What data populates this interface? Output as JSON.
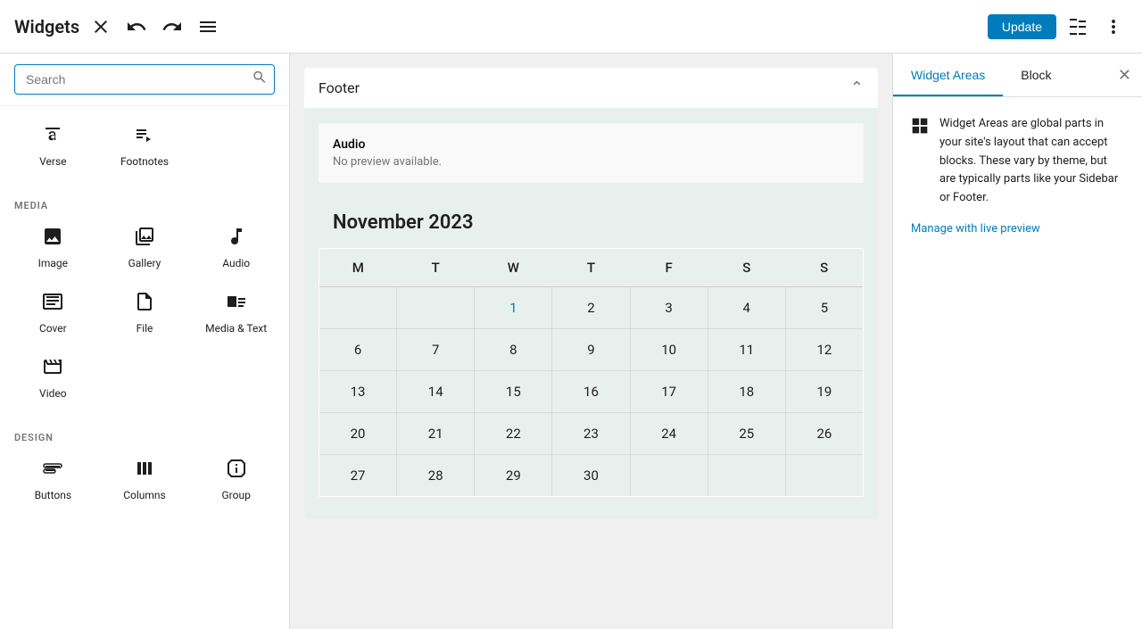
{
  "topbar": {
    "title": "Widgets",
    "update_label": "Update"
  },
  "sidebar": {
    "search": {
      "placeholder": "Search",
      "value": ""
    },
    "sections": [
      {
        "id": "text",
        "label": "",
        "blocks": [
          {
            "id": "verse",
            "icon": "verse",
            "label": "Verse"
          },
          {
            "id": "footnotes",
            "icon": "footnotes",
            "label": "Footnotes"
          }
        ]
      },
      {
        "id": "media",
        "label": "MEDIA",
        "blocks": [
          {
            "id": "image",
            "icon": "image",
            "label": "Image"
          },
          {
            "id": "gallery",
            "icon": "gallery",
            "label": "Gallery"
          },
          {
            "id": "audio",
            "icon": "audio",
            "label": "Audio"
          },
          {
            "id": "cover",
            "icon": "cover",
            "label": "Cover"
          },
          {
            "id": "file",
            "icon": "file",
            "label": "File"
          },
          {
            "id": "media-text",
            "icon": "media-text",
            "label": "Media & Text"
          },
          {
            "id": "video",
            "icon": "video",
            "label": "Video"
          }
        ]
      },
      {
        "id": "design",
        "label": "DESIGN",
        "blocks": [
          {
            "id": "buttons",
            "icon": "buttons",
            "label": "Buttons"
          },
          {
            "id": "columns",
            "icon": "columns",
            "label": "Columns"
          },
          {
            "id": "group",
            "icon": "group",
            "label": "Group"
          }
        ]
      }
    ]
  },
  "footer_widget": {
    "title": "Footer"
  },
  "audio_block": {
    "title": "Audio",
    "subtitle": "No preview available."
  },
  "calendar": {
    "month_title": "November 2023",
    "headers": [
      "M",
      "T",
      "W",
      "T",
      "F",
      "S",
      "S"
    ],
    "weeks": [
      [
        "",
        "",
        "1",
        "2",
        "3",
        "4",
        "5"
      ],
      [
        "6",
        "7",
        "8",
        "9",
        "10",
        "11",
        "12"
      ],
      [
        "13",
        "14",
        "15",
        "16",
        "17",
        "18",
        "19"
      ],
      [
        "20",
        "21",
        "22",
        "23",
        "24",
        "25",
        "26"
      ],
      [
        "27",
        "28",
        "29",
        "30",
        "",
        "",
        ""
      ]
    ]
  },
  "right_panel": {
    "tab_widget_areas": "Widget Areas",
    "tab_block": "Block",
    "description": "Widget Areas are global parts in your site's layout that can accept blocks. These vary by theme, but are typically parts like your Sidebar or Footer.",
    "manage_link": "Manage with live preview"
  }
}
